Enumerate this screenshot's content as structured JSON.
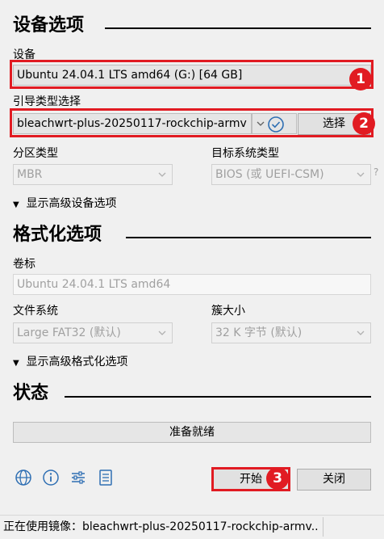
{
  "device_section": {
    "title": "设备选项",
    "device_label": "设备",
    "device_value": "Ubuntu 24.04.1 LTS amd64 (G:) [64 GB]",
    "boot_label": "引导类型选择",
    "boot_value": "bleachwrt-plus-20250117-rockchip-armv",
    "select_button": "选择",
    "partition_label": "分区类型",
    "partition_value": "MBR",
    "target_label": "目标系统类型",
    "target_value": "BIOS (或 UEFI-CSM)",
    "help_mark": "?",
    "advanced_toggle": "显示高级设备选项"
  },
  "format_section": {
    "title": "格式化选项",
    "volume_label": "卷标",
    "volume_value": "Ubuntu 24.04.1 LTS amd64",
    "fs_label": "文件系统",
    "fs_value": "Large FAT32 (默认)",
    "cluster_label": "簇大小",
    "cluster_value": "32 K 字节 (默认)",
    "advanced_toggle": "显示高级格式化选项"
  },
  "status_section": {
    "title": "状态",
    "progress_text": "准备就绪",
    "progress_fraction": 0
  },
  "buttons": {
    "start": "开始",
    "close": "关闭"
  },
  "badges": [
    "1",
    "2",
    "3"
  ],
  "footer": {
    "status_text": "正在使用镜像：bleachwrt-plus-20250117-rockchip-armv..."
  },
  "icons": [
    "globe-icon",
    "info-icon",
    "settings-sliders-icon",
    "log-icon"
  ],
  "colors": {
    "highlight": "#e11b22",
    "link_blue": "#2f6fb3"
  }
}
